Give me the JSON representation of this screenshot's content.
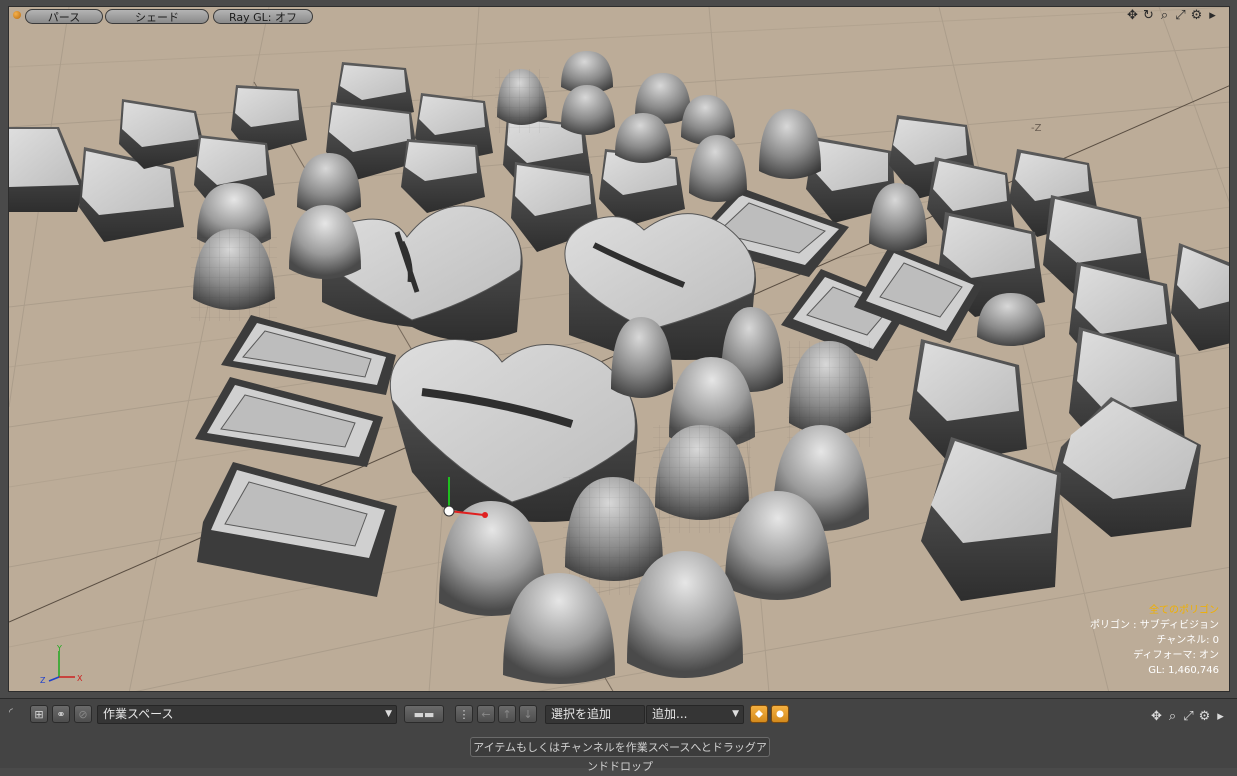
{
  "viewport": {
    "view_label": "パース",
    "shade_label": "シェード",
    "raygl_label": "Ray GL: オフ",
    "icons": [
      "move-view-icon",
      "rotate-view-icon",
      "zoom-view-icon",
      "maximize-icon",
      "settings-gear-icon",
      "menu-arrow-icon"
    ],
    "hud": {
      "title": "全てのポリゴン",
      "polygons": "ポリゴン : サブディビジョン",
      "channels": "チャンネル: 0",
      "deformer": "ディフォーマ: オン",
      "gl": "GL: 1,460,746"
    },
    "axis": {
      "y": "Y",
      "z": "Z",
      "x": "X"
    },
    "grid_label_neg_z": "-Z",
    "colors": {
      "background": "#bcac98",
      "grid": "#a89a88",
      "object": "#c8c8c8",
      "hud_title": "#f0b000"
    }
  },
  "toolbar": {
    "workspace_select": "作業スペース",
    "add_selection_label": "選択を追加",
    "add_menu_label": "追加...",
    "drop_hint": "アイテムもしくはチャンネルを作業スペースへとドラッグアンドドロップ",
    "icons": [
      "move-view-icon",
      "zoom-view-icon",
      "maximize-icon",
      "settings-gear-icon",
      "menu-arrow-icon"
    ]
  }
}
